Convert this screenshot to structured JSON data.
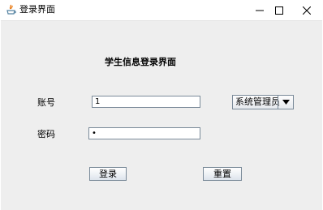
{
  "window": {
    "title": "登录界面",
    "controls": {
      "minimize": "—",
      "maximize": "☐",
      "close": "✕"
    }
  },
  "form": {
    "heading": "学生信息登录界面",
    "account_label": "账号",
    "account_value": "1",
    "password_label": "密码",
    "password_value": "•",
    "role_selected": "系统管理员"
  },
  "buttons": {
    "login": "登录",
    "reset": "重置"
  },
  "colors": {
    "panel_bg": "#eeeeee",
    "border": "#7a8a99",
    "java_icon_red": "#e76f00",
    "java_icon_blue": "#5382a1"
  },
  "icons": [
    "java-app-icon",
    "minimize-icon",
    "maximize-icon",
    "close-icon",
    "dropdown-arrow-icon"
  ]
}
